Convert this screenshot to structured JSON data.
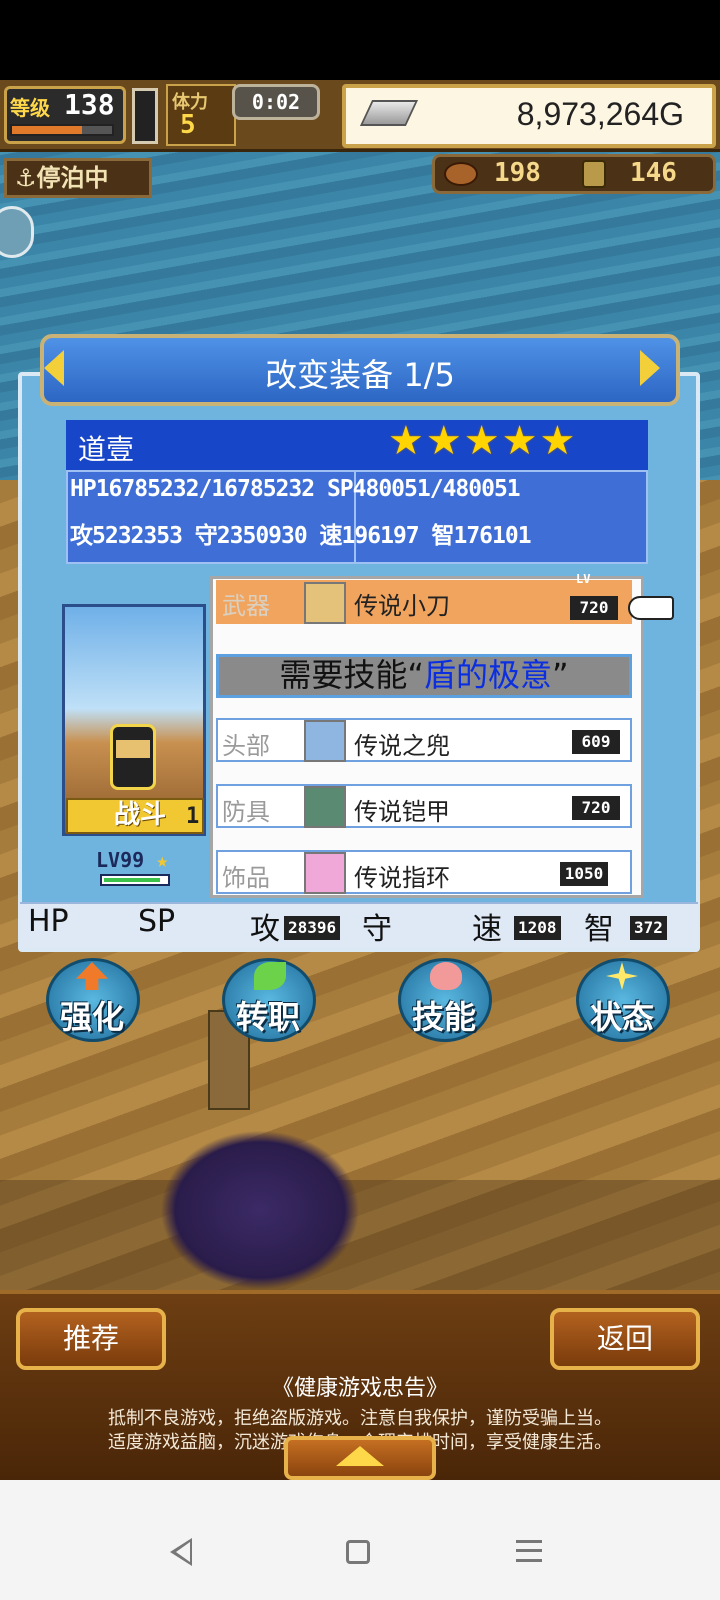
{
  "hud": {
    "level_label": "等级",
    "level": "138",
    "stamina_label": "体力",
    "stamina": "5",
    "timer": "0:02",
    "gold": "8,973,264G",
    "dock_status": "停泊中",
    "resource1": "198",
    "resource2": "146",
    "xp_fraction": 0.7
  },
  "panel": {
    "title": "改变装备 1/5",
    "char_name": "道壹",
    "stars": "★★★★★",
    "stats_row1": "HP16785232/16785232  SP480051/480051",
    "stats_row2": "攻5232353 守2350930 速196197 智176101",
    "class_label": "战斗",
    "class_rank": "1",
    "char_level": "LV99",
    "char_hp_fraction": 0.9,
    "required_prefix": "需要技能“",
    "required_skill": "盾的极意",
    "required_suffix": "”",
    "equipment": [
      {
        "slot": "武器",
        "name": "传说小刀",
        "level": "720",
        "level_label": "LV",
        "icon": "dagger-icon"
      },
      {
        "slot": "头部",
        "name": "传说之兜",
        "level": "609",
        "icon": "helmet-icon"
      },
      {
        "slot": "防具",
        "name": "传说铠甲",
        "level": "720",
        "icon": "armor-icon"
      },
      {
        "slot": "饰品",
        "name": "传说指环",
        "level": "1050",
        "icon": "ring-icon"
      }
    ],
    "bottom": {
      "hp_label": "HP",
      "sp_label": "SP",
      "atk_label": "攻",
      "atk_val": "28396",
      "def_label": "守",
      "spd_label": "速",
      "spd_val": "1208",
      "int_label": "智",
      "int_val": "372"
    }
  },
  "actions": [
    {
      "label": "强化",
      "icon": "arrow-up-icon",
      "color": "#f07a2a"
    },
    {
      "label": "转职",
      "icon": "leaf-icon",
      "color": "#6cd24a"
    },
    {
      "label": "技能",
      "icon": "flame-icon",
      "color": "#f29a9a"
    },
    {
      "label": "状态",
      "icon": "sparkle-icon",
      "color": "#ffe86a"
    }
  ],
  "footer": {
    "recommend": "推荐",
    "back": "返回",
    "notice_title": "《健康游戏忠告》",
    "notice_line1": "抵制不良游戏，拒绝盗版游戏。注意自我保护，谨防受骗上当。",
    "notice_line2": "适度游戏益脑，沉迷游戏伤身。合理安排时间，享受健康生活。"
  }
}
